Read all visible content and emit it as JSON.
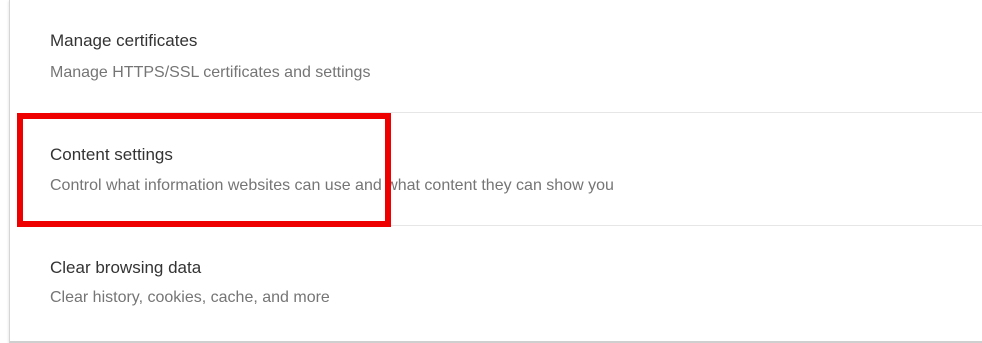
{
  "settings": {
    "items": [
      {
        "title": "Manage certificates",
        "description": "Manage HTTPS/SSL certificates and settings"
      },
      {
        "title": "Content settings",
        "description": "Control what information websites can use and what content they can show you"
      },
      {
        "title": "Clear browsing data",
        "description": "Clear history, cookies, cache, and more"
      }
    ]
  },
  "annotation": {
    "highlight_color": "#ee0000",
    "highlighted_item": "Content settings"
  }
}
